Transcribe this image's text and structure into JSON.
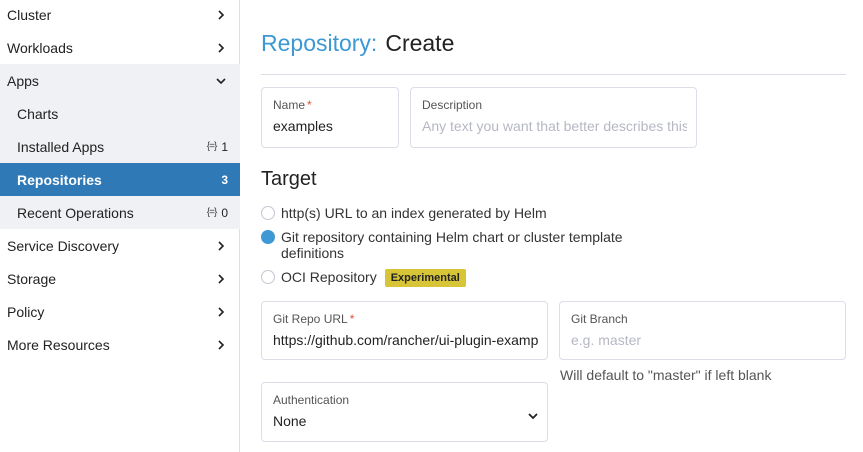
{
  "sidebar": {
    "cluster": "Cluster",
    "workloads": "Workloads",
    "apps": "Apps",
    "apps_items": [
      {
        "label": "Charts",
        "badge": "",
        "count": ""
      },
      {
        "label": "Installed Apps",
        "badge": "{=}",
        "count": "1"
      },
      {
        "label": "Repositories",
        "badge": "",
        "count": "3"
      },
      {
        "label": "Recent Operations",
        "badge": "{=}",
        "count": "0"
      }
    ],
    "service_discovery": "Service Discovery",
    "storage": "Storage",
    "policy": "Policy",
    "more_resources": "More Resources"
  },
  "header": {
    "crumb": "Repository:",
    "action": "Create"
  },
  "form": {
    "name_label": "Name",
    "required_mark": "*",
    "name_value": "examples",
    "description_label": "Description",
    "description_placeholder": "Any text you want that better describes this",
    "target_title": "Target",
    "target_options": [
      {
        "label": "http(s) URL to an index generated by Helm",
        "checked": false
      },
      {
        "label_line1": "Git repository containing Helm chart or cluster template",
        "label_line2": "definitions",
        "checked": true
      },
      {
        "label": "OCI Repository",
        "badge": "Experimental",
        "checked": false
      }
    ],
    "git_repo_label": "Git Repo URL",
    "git_repo_value": "https://github.com/rancher/ui-plugin-examp",
    "git_branch_label": "Git Branch",
    "git_branch_placeholder": "e.g. master",
    "git_branch_hint": "Will default to \"master\" if left blank",
    "auth_label": "Authentication",
    "auth_value": "None"
  },
  "colors": {
    "accent": "#3d98d3",
    "active_nav": "#2f79b7",
    "experimental_badge": "#d8c437",
    "required": "#e0503a"
  }
}
